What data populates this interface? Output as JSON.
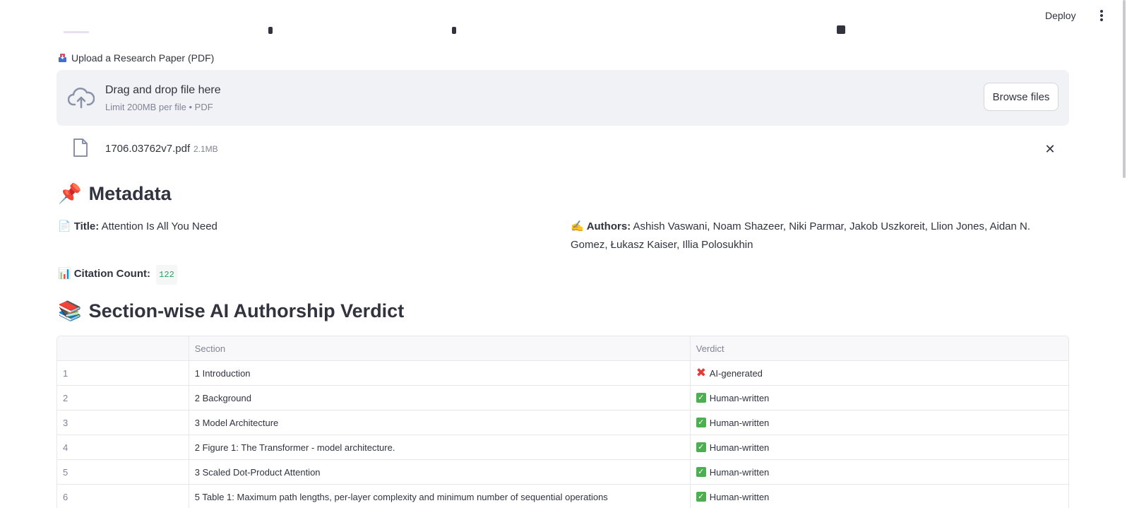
{
  "header": {
    "deploy_label": "Deploy",
    "menu_icon": "kebab-menu-icon"
  },
  "upload": {
    "label": "Upload a Research Paper (PDF)",
    "label_icon": "inbox-tray-icon",
    "dropzone_title": "Drag and drop file here",
    "dropzone_subtitle": "Limit 200MB per file • PDF",
    "browse_label": "Browse files",
    "dropzone_icon": "cloud-upload-icon"
  },
  "file": {
    "name": "1706.03762v7.pdf",
    "size": "2.1MB",
    "icon": "document-icon",
    "close_glyph": "✕"
  },
  "metadata": {
    "heading": "Metadata",
    "heading_emoji": "📌",
    "title_emoji": "📄",
    "title_label": "Title:",
    "title_value": "Attention Is All You Need",
    "authors_emoji": "✍️",
    "authors_label": "Authors:",
    "authors_value": "Ashish Vaswani, Noam Shazeer, Niki Parmar, Jakob Uszkoreit, Llion Jones, Aidan N. Gomez, Łukasz Kaiser, Illia Polosukhin",
    "citation_emoji": "📊",
    "citation_label": "Citation Count:",
    "citation_value": "122"
  },
  "verdict": {
    "heading": "Section-wise AI Authorship Verdict",
    "heading_emoji": "📚",
    "columns": [
      "",
      "Section",
      "Verdict"
    ],
    "rows": [
      {
        "index": "1",
        "section": "1 Introduction",
        "verdict": "AI-generated",
        "kind": "bad"
      },
      {
        "index": "2",
        "section": "2 Background",
        "verdict": "Human-written",
        "kind": "ok"
      },
      {
        "index": "3",
        "section": "3 Model Architecture",
        "verdict": "Human-written",
        "kind": "ok"
      },
      {
        "index": "4",
        "section": "2  Figure 1: The Transformer - model architecture.",
        "verdict": "Human-written",
        "kind": "ok"
      },
      {
        "index": "5",
        "section": "3  Scaled Dot-Product Attention",
        "verdict": "Human-written",
        "kind": "ok"
      },
      {
        "index": "6",
        "section": "5  Table 1: Maximum path lengths, per-layer complexity and minimum number of sequential operations",
        "verdict": "Human-written",
        "kind": "ok"
      }
    ]
  },
  "colors": {
    "dropzone_bg": "#f0f2f6",
    "text": "#31333f",
    "muted": "#808495",
    "ok": "#4caf50",
    "bad": "#e53935",
    "badge_green": "#21a366"
  }
}
